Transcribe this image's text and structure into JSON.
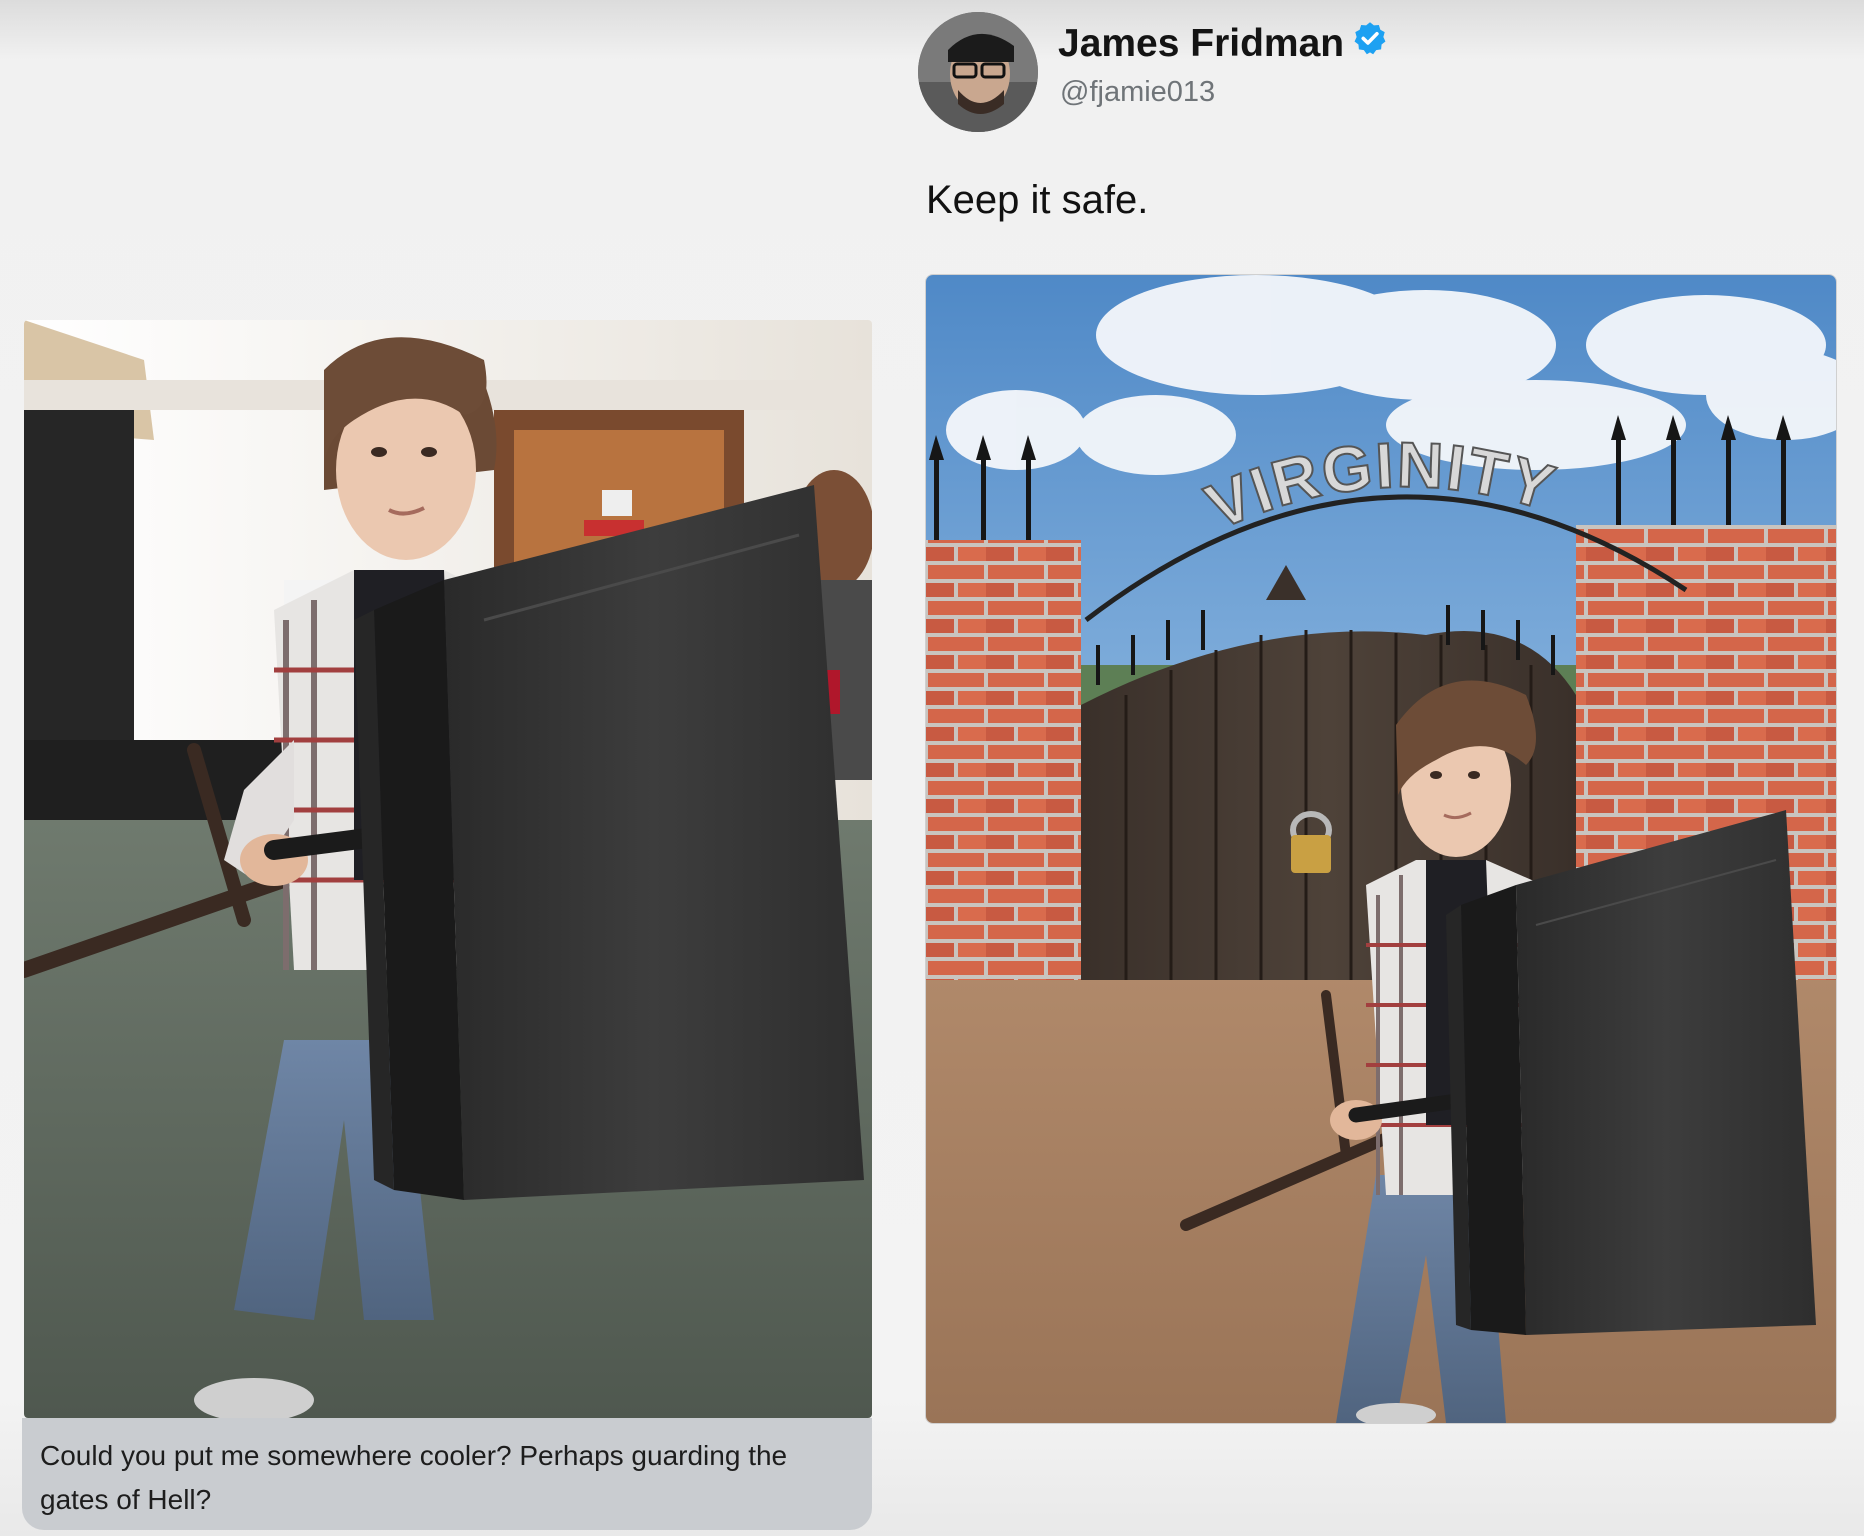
{
  "tweet": {
    "author_name": "James Fridman",
    "author_handle": "@fjamie013",
    "verified_icon": "verified-badge-icon",
    "text": "Keep it safe.",
    "badge_color": "#1da1f2"
  },
  "original_post": {
    "caption": "Could you put me somewhere cooler? Perhaps guarding the gates of Hell?"
  },
  "edited_image": {
    "arch_sign": "VIRGINITY"
  }
}
